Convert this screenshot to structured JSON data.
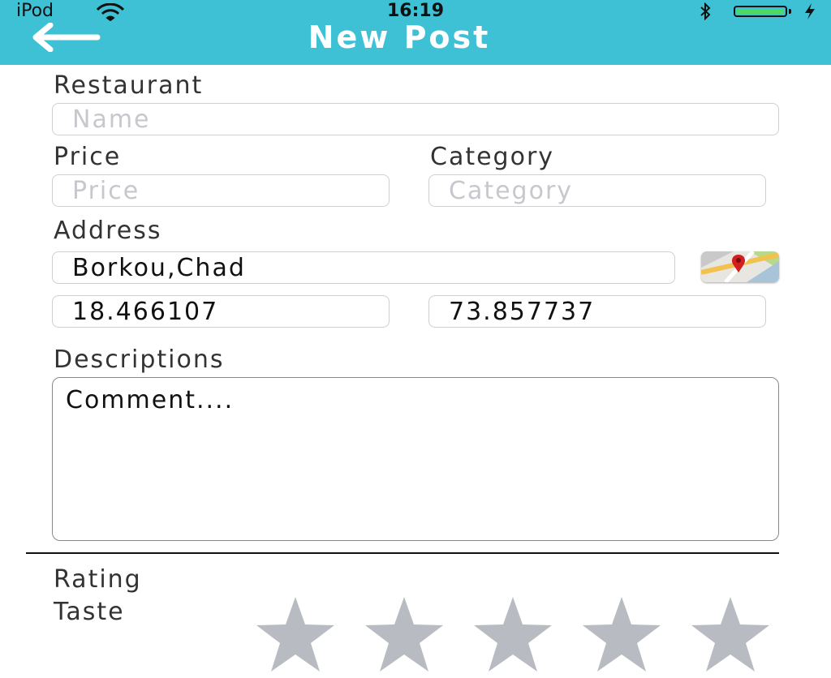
{
  "status_bar": {
    "carrier": "iPod",
    "time": "16:19",
    "battery_level": 1.0
  },
  "nav": {
    "title": "New Post",
    "back_icon": "arrow-left-icon"
  },
  "form": {
    "restaurant": {
      "label": "Restaurant",
      "placeholder": "Name",
      "value": ""
    },
    "price": {
      "label": "Price",
      "placeholder": "Price",
      "value": ""
    },
    "category": {
      "label": "Category",
      "placeholder": "Category",
      "value": ""
    },
    "address": {
      "label": "Address",
      "value": "Borkou,Chad",
      "map_icon": "maps-icon"
    },
    "latitude": {
      "value": "18.466107"
    },
    "longitude": {
      "value": "73.857737"
    },
    "descriptions": {
      "label": "Descriptions",
      "value": "Comment...."
    }
  },
  "rating": {
    "label": "Rating",
    "taste": {
      "label": "Taste",
      "max_stars": 5,
      "value": 0
    }
  },
  "colors": {
    "nav_bar": "#3ec1d5",
    "star_inactive": "#b8bcc2",
    "battery": "#4cd964"
  }
}
